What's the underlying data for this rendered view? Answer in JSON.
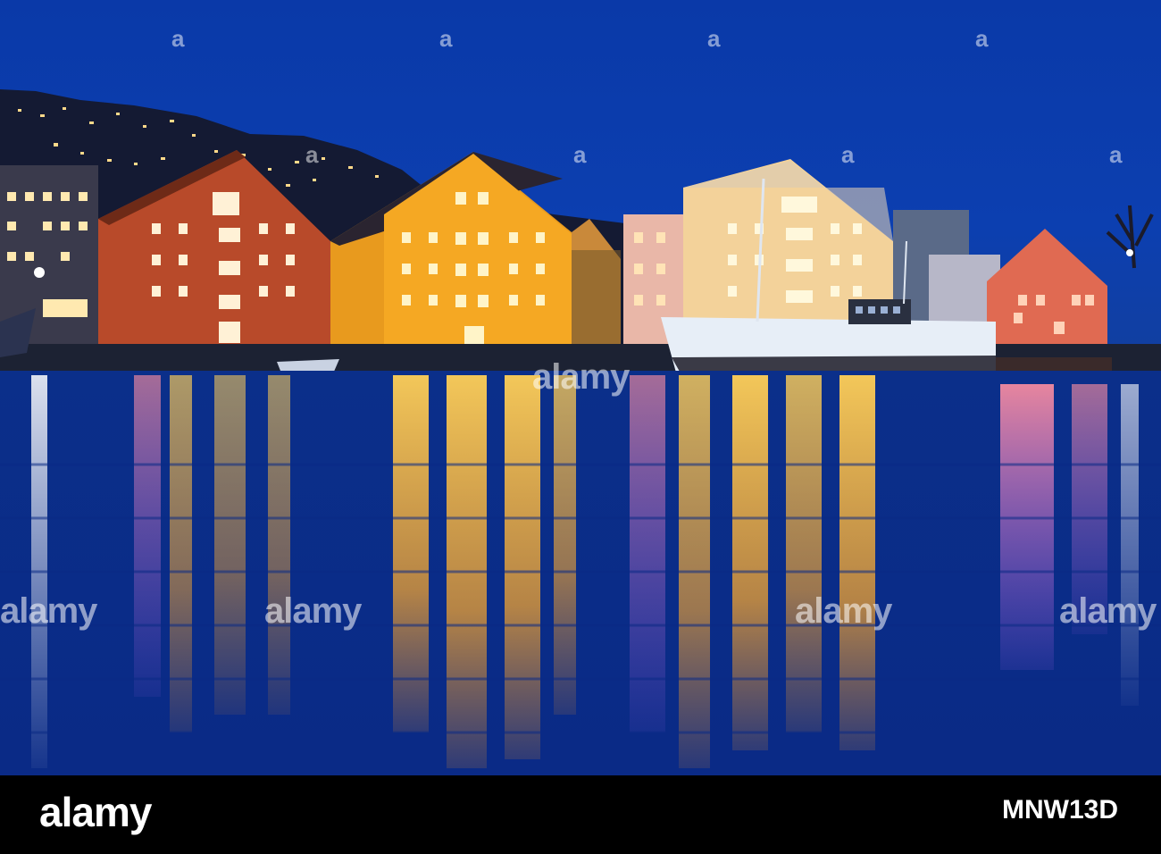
{
  "scene": {
    "description_colors": {
      "sky": "#0b3ba6",
      "water": "#0a2f8c",
      "warm_light": "#ffb43a"
    }
  },
  "watermark": {
    "logo_text": "alamy",
    "mark": "a"
  },
  "footer": {
    "logo_text": "alamy",
    "image_id": "MNW13D"
  }
}
